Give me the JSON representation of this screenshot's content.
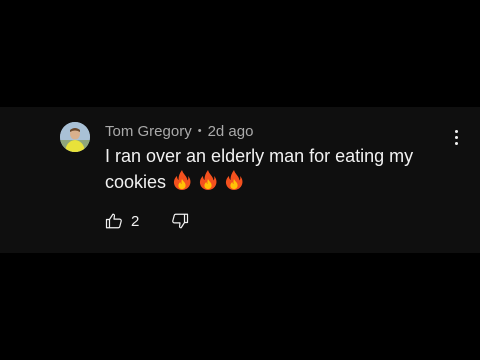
{
  "comment": {
    "author": "Tom Gregory",
    "separator": "•",
    "timestamp": "2d ago",
    "text": "I ran over an elderly man for eating my cookies",
    "emojis": [
      "fire-icon",
      "fire-icon",
      "fire-icon"
    ],
    "like_count": "2"
  },
  "colors": {
    "background": "#000000",
    "card": "#0f0f0f",
    "text_primary": "#f1f1f1",
    "text_secondary": "#aaaaaa"
  },
  "icons": {
    "like": "thumbs-up-icon",
    "dislike": "thumbs-down-icon",
    "more": "vertical-ellipsis-icon"
  }
}
